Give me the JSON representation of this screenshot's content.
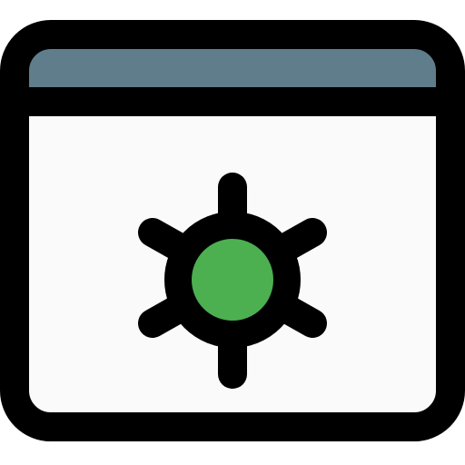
{
  "icon": {
    "name": "browser-settings-icon",
    "colors": {
      "outline": "#000000",
      "title_bar": "#607d8b",
      "window_body": "#fafafa",
      "gear_center": "#4caf50"
    }
  }
}
